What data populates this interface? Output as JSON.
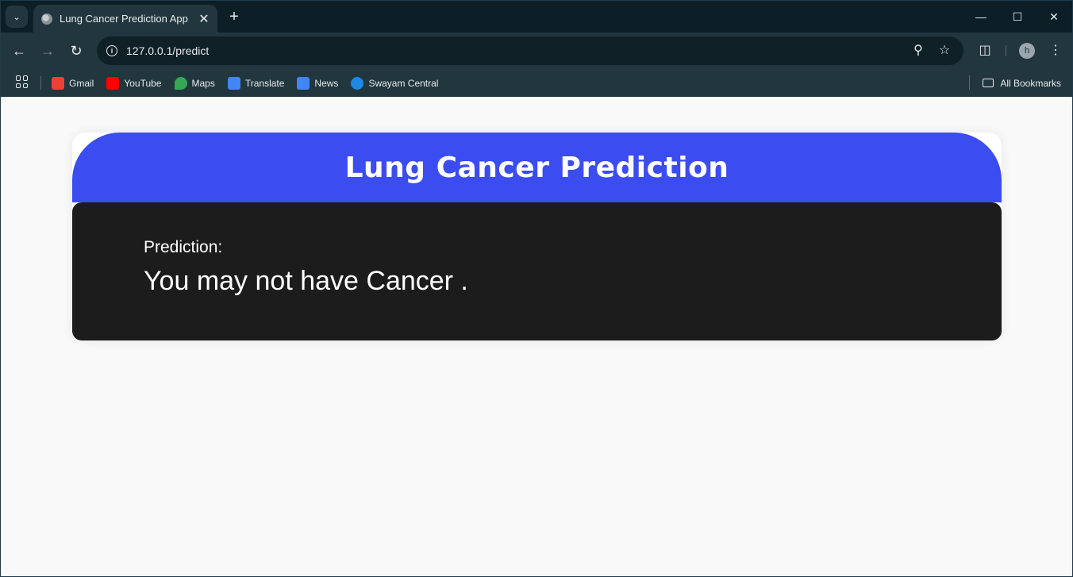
{
  "browser": {
    "tab_title": "Lung Cancer Prediction App",
    "url": "127.0.0.1/predict",
    "profile_initial": "h",
    "bookmarks": [
      {
        "label": "Gmail",
        "icon": "gmail-icon",
        "color": "#ea4335"
      },
      {
        "label": "YouTube",
        "icon": "youtube-icon",
        "color": "#ff0000"
      },
      {
        "label": "Maps",
        "icon": "maps-icon",
        "color": "#34a853"
      },
      {
        "label": "Translate",
        "icon": "translate-icon",
        "color": "#4285f4"
      },
      {
        "label": "News",
        "icon": "news-icon",
        "color": "#4285f4"
      },
      {
        "label": "Swayam Central",
        "icon": "swayam-icon",
        "color": "#1e88e5"
      }
    ],
    "all_bookmarks_label": "All Bookmarks"
  },
  "page": {
    "header_title": "Lung Cancer Prediction",
    "prediction_label": "Prediction:",
    "prediction_value": "You may not have Cancer ."
  },
  "colors": {
    "header_bg": "#3b4cf1",
    "result_bg": "#1c1c1d",
    "page_bg": "#f9f9f9"
  }
}
